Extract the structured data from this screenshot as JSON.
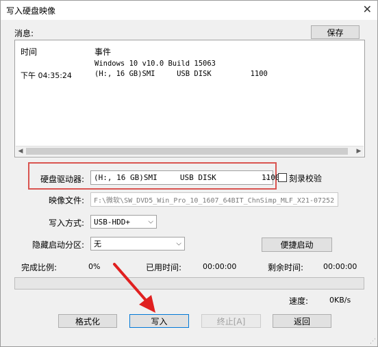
{
  "window": {
    "title": "写入硬盘映像",
    "close_glyph": "✕"
  },
  "messages": {
    "label": "消息:",
    "save_label": "保存",
    "col_time": "时间",
    "col_event": "事件",
    "rows": [
      {
        "time": "",
        "event": "Windows 10 v10.0 Build 15063"
      },
      {
        "time": "下午 04:35:24",
        "event": "(H:, 16 GB)SMI     USB DISK         1100"
      }
    ]
  },
  "drive": {
    "label": "硬盘驱动器:",
    "value": "(H:, 16 GB)SMI     USB DISK          1100",
    "verify_label": "刻录校验"
  },
  "image_file": {
    "label": "映像文件:",
    "value": "F:\\微软\\SW_DVD5_Win_Pro_10_1607_64BIT_ChnSimp_MLF_X21-07252"
  },
  "write_method": {
    "label": "写入方式:",
    "value": "USB-HDD+"
  },
  "hidden_partition": {
    "label": "隐藏启动分区:",
    "value": "无"
  },
  "quick_boot_label": "便捷启动",
  "status": {
    "completion_label": "完成比例:",
    "completion_value": "0%",
    "elapsed_label": "已用时间:",
    "elapsed_value": "00:00:00",
    "remaining_label": "剩余时间:",
    "remaining_value": "00:00:00",
    "speed_label": "速度:",
    "speed_value": "0KB/s",
    "progress_fraction": 0
  },
  "buttons": {
    "format": "格式化",
    "write": "写入",
    "stop": "终止[A]",
    "back": "返回"
  },
  "icons": {
    "dropdown": "chevron-down-icon",
    "scroll_left": "arrow-left-icon",
    "scroll_right": "arrow-right-icon"
  },
  "colors": {
    "highlight": "#d9534f",
    "progress_fill": "#06b025"
  }
}
